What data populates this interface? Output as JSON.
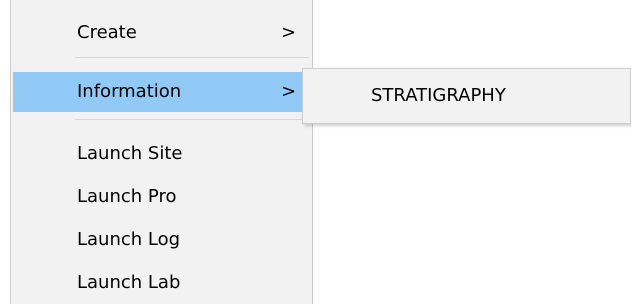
{
  "menu": {
    "items": [
      {
        "label": "Create",
        "has_submenu": true,
        "arrow": ">"
      },
      {
        "label": "Information",
        "has_submenu": true,
        "arrow": ">",
        "highlighted": true
      },
      {
        "label": "Launch Site"
      },
      {
        "label": "Launch Pro"
      },
      {
        "label": "Launch Log"
      },
      {
        "label": "Launch Lab"
      }
    ]
  },
  "submenu": {
    "items": [
      {
        "label": "STRATIGRAPHY"
      }
    ]
  },
  "colors": {
    "menu_background": "#f2f2f2",
    "highlight": "#91c9f7",
    "border": "#cccccc",
    "text": "#000000"
  }
}
